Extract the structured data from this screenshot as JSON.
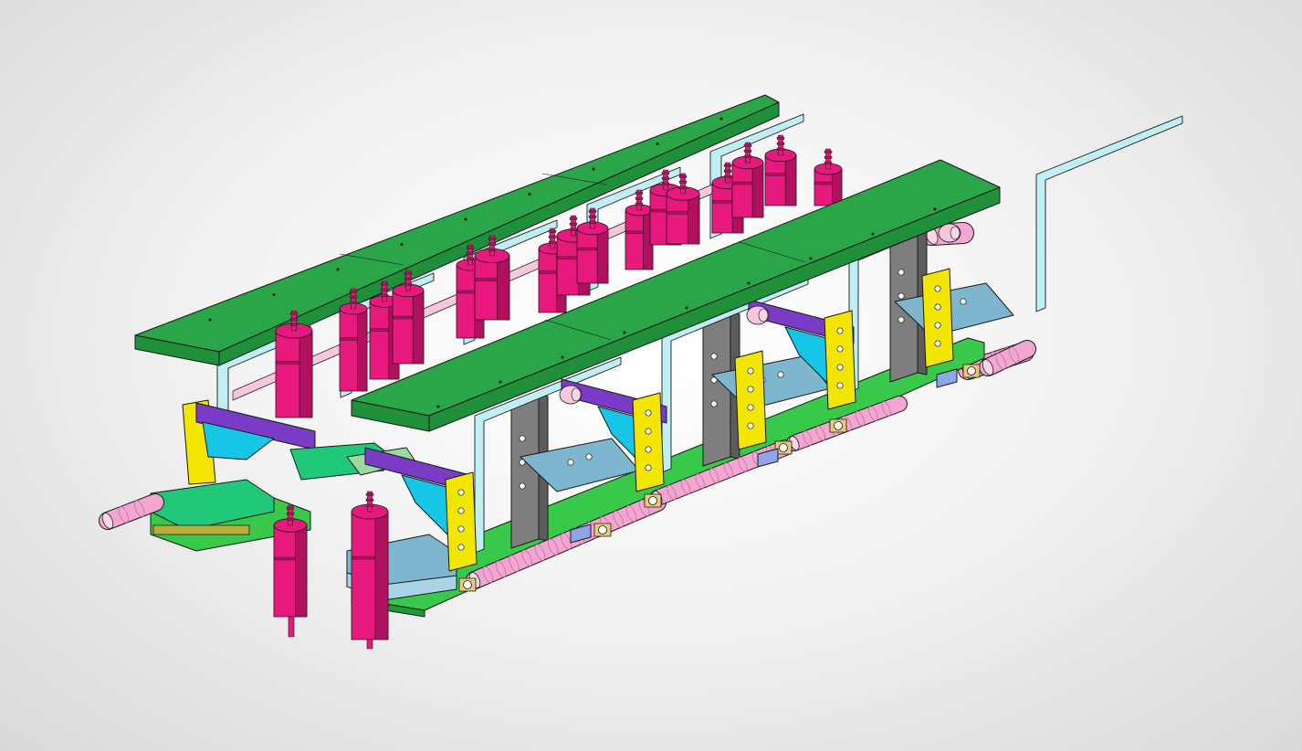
{
  "viewport": {
    "view": "isometric",
    "render_style": "shaded-with-edges"
  },
  "assembly": {
    "rows": 2,
    "stations_per_row": 4,
    "edge_color": "#1a1a1a",
    "part_colors": {
      "top_plate": "#1f8f3a",
      "top_plate_top": "#2aa548",
      "base_plate": "#38c84a",
      "cylinder": "#e8197c",
      "cylinder_dark": "#b0105e",
      "tube": "#f3a6d2",
      "bracket_yellow": "#f2e600",
      "column_gray": "#7e7e7e",
      "frame_cyan": "#bfeff2",
      "block_blue": "#7fb6cf",
      "block_purple": "#7a3cc6",
      "wedge_cyan": "#17c6e6",
      "pad_green": "#21c87a",
      "spacer_olive": "#b8ad3a",
      "slide_pink": "#f6c6dd",
      "fitting_tan": "#e8c87a"
    }
  }
}
